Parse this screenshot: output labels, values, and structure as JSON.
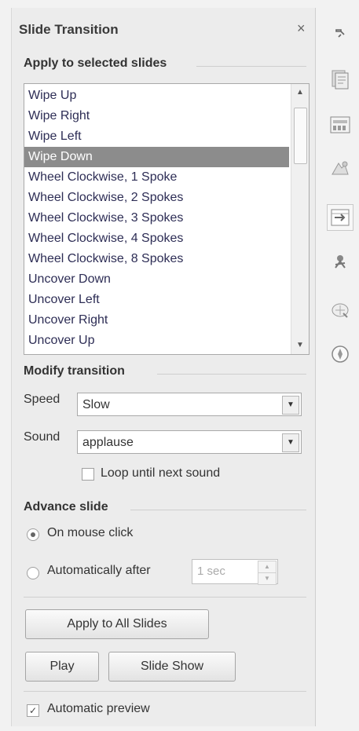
{
  "panel": {
    "title": "Slide Transition",
    "close_glyph": "×"
  },
  "sections": {
    "apply": "Apply to selected slides",
    "modify": "Modify transition",
    "advance": "Advance slide"
  },
  "transitions": [
    "Wipe Up",
    "Wipe Right",
    "Wipe Left",
    "Wipe Down",
    "Wheel Clockwise, 1 Spoke",
    "Wheel Clockwise, 2 Spokes",
    "Wheel Clockwise, 3 Spokes",
    "Wheel Clockwise, 4 Spokes",
    "Wheel Clockwise, 8 Spokes",
    "Uncover Down",
    "Uncover Left",
    "Uncover Right",
    "Uncover Up"
  ],
  "selected_transition": "Wipe Down",
  "modify": {
    "speed_label": "Speed",
    "speed_value": "Slow",
    "sound_label": "Sound",
    "sound_value": "applause",
    "loop_label": "Loop until next sound",
    "loop_checked": false
  },
  "advance": {
    "on_click_label": "On mouse click",
    "on_click_selected": true,
    "auto_label": "Automatically after",
    "auto_selected": false,
    "auto_value": "1 sec"
  },
  "buttons": {
    "apply_all": "Apply to All Slides",
    "play": "Play",
    "slide_show": "Slide Show"
  },
  "preview": {
    "label": "Automatic preview",
    "checked": true,
    "check_glyph": "✓"
  },
  "icons": {
    "scroll_up": "▲",
    "scroll_down": "▼",
    "dropdown": "▼"
  },
  "toolbar_icons": [
    "pin-icon",
    "properties-icon",
    "slide-layouts-icon",
    "styles-icon",
    "slide-transition-icon",
    "animation-icon",
    "navigator-icon",
    "compass-icon"
  ]
}
